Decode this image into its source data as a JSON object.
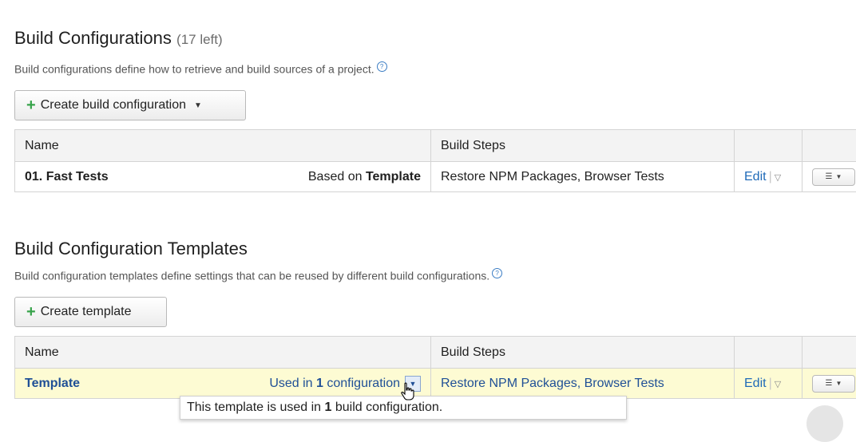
{
  "configs": {
    "title": "Build Configurations",
    "count": "(17 left)",
    "description": "Build configurations define how to retrieve and build sources of a project.",
    "help_icon": "?",
    "create_label": "Create build configuration",
    "table": {
      "col_name": "Name",
      "col_steps": "Build Steps",
      "rows": [
        {
          "name": "01. Fast Tests",
          "based_prefix": "Based on ",
          "based_template": "Template",
          "steps": "Restore NPM Packages, Browser Tests",
          "edit": "Edit"
        }
      ]
    }
  },
  "templates": {
    "title": "Build Configuration Templates",
    "description": "Build configuration templates define settings that can be reused by different build configurations.",
    "help_icon": "?",
    "create_label": "Create template",
    "table": {
      "col_name": "Name",
      "col_steps": "Build Steps",
      "rows": [
        {
          "name": "Template",
          "used_prefix": "Used in ",
          "used_count": "1",
          "used_suffix": " configuration",
          "steps": "Restore NPM Packages, Browser Tests",
          "edit": "Edit"
        }
      ]
    }
  },
  "tooltip": {
    "prefix": "This template is used in ",
    "count": "1",
    "suffix": " build configuration."
  },
  "icons": {
    "plus": "+",
    "caret": "▼",
    "triangle": "▽",
    "list": "☰"
  },
  "colors": {
    "accent_link": "#1f4f96",
    "plus_green": "#37a34a",
    "highlight_row": "#fdfbd3"
  }
}
